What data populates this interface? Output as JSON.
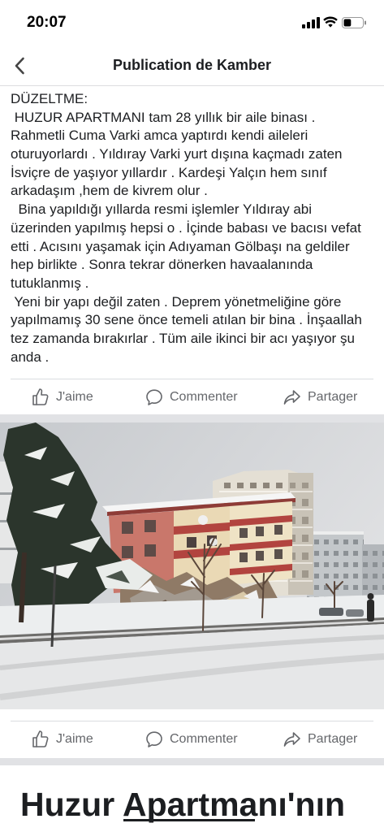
{
  "status_bar": {
    "time": "20:07",
    "battery_level": 0.4,
    "icons": [
      "signal-icon",
      "wifi-icon",
      "battery-icon"
    ]
  },
  "nav": {
    "back_icon": "chevron-left-icon",
    "title": "Publication de Kamber"
  },
  "post": {
    "text_lines": [
      "DÜZELTME:",
      " HUZUR APARTMANI tam 28 yıllık bir aile binası .",
      "Rahmetli Cuma Varki amca yaptırdı kendi aileleri",
      "oturuyorlardı . Yıldıray Varki yurt dışına kaçmadı zaten",
      "İsviçre de yaşıyor yıllardır . Kardeşi Yalçın hem sınıf",
      "arkadaşım ,hem de kivrem olur .",
      "  Bina yapıldığı yıllarda resmi işlemler Yıldıray abi",
      "üzerinden yapılmış hepsi o . İçinde babası ve bacısı vefat",
      "etti . Acısını yaşamak için Adıyaman Gölbaşı na geldiler",
      "hep birlikte . Sonra tekrar dönerken havaalanında",
      "tutuklanmış .",
      " Yeni bir yapı değil zaten . Deprem yönetmeliğine göre",
      "yapılmamış 30 sene önce temeli atılan bir bina . İnşaallah",
      "tez zamanda bırakırlar . Tüm aile ikinci bir acı yaşıyor şu",
      "anda ."
    ],
    "actions": {
      "like": "J'aime",
      "comment": "Commenter",
      "share": "Partager"
    }
  },
  "photo": {
    "actions": {
      "like": "J'aime",
      "comment": "Commenter",
      "share": "Partager"
    }
  },
  "article_preview": {
    "title": "Huzur Apartmanı'nın"
  },
  "icons": {
    "like": "thumbs-up-icon",
    "comment": "comment-icon",
    "share": "share-icon"
  },
  "colors": {
    "text": "#1c1e21",
    "secondary_text": "#65676b",
    "divider": "#dadde1",
    "separator": "#e1e2e5"
  }
}
